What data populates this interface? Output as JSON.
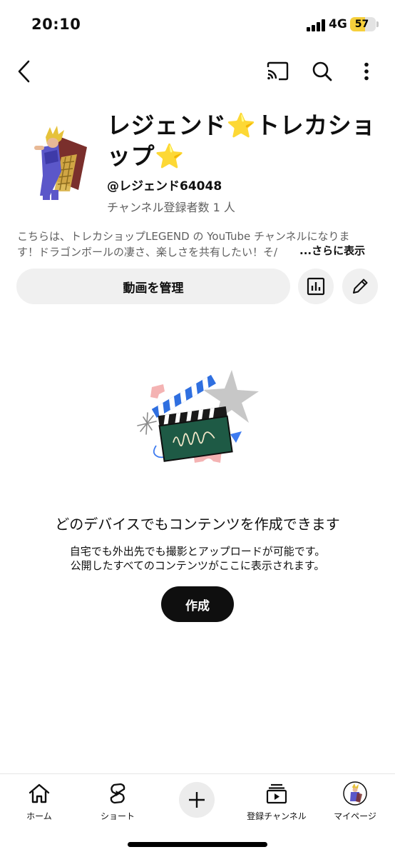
{
  "status_bar": {
    "time": "20:10",
    "network": "4G",
    "battery_level": "57",
    "battery_fraction": 0.57
  },
  "top_nav": {
    "back_icon": "chevron-left-icon",
    "cast_icon": "cast-icon",
    "search_icon": "search-icon",
    "more_icon": "more-vert-icon"
  },
  "channel": {
    "title_part1": "レジェンド",
    "title_star1": "⭐",
    "title_part2": "トレカショップ",
    "title_star2": "⭐",
    "handle": "@レジェンド64048",
    "subscribers": "チャンネル登録者数 1 人",
    "description_line1": "こちらは、トレカショップLEGEND の YouTube チャンネルになりま",
    "description_line2": "す！ドラゴンボールの凄さ、楽しさを共有したい！そ/",
    "more_label": "...さらに表示"
  },
  "actions": {
    "manage_label": "動画を管理",
    "analytics_icon": "analytics-icon",
    "edit_icon": "pencil-icon"
  },
  "empty_state": {
    "illustration": "clapperboard-illustration",
    "title": "どのデバイスでもコンテンツを作成できます",
    "line1": "自宅でも外出先でも撮影とアップロードが可能です。",
    "line2": "公開したすべてのコンテンツがここに表示されます。",
    "create_label": "作成"
  },
  "bottom_nav": {
    "items": [
      {
        "label": "ホーム",
        "icon": "home-icon"
      },
      {
        "label": "ショート",
        "icon": "shorts-icon"
      },
      {
        "label": "",
        "icon": "plus-icon"
      },
      {
        "label": "登録チャンネル",
        "icon": "subscriptions-icon"
      },
      {
        "label": "マイページ",
        "icon": "avatar"
      }
    ]
  },
  "colors": {
    "text": "#0f0f0f",
    "secondary_text": "#606060",
    "button_bg": "#f0f0f0",
    "battery_fill": "#f6cf3b"
  }
}
